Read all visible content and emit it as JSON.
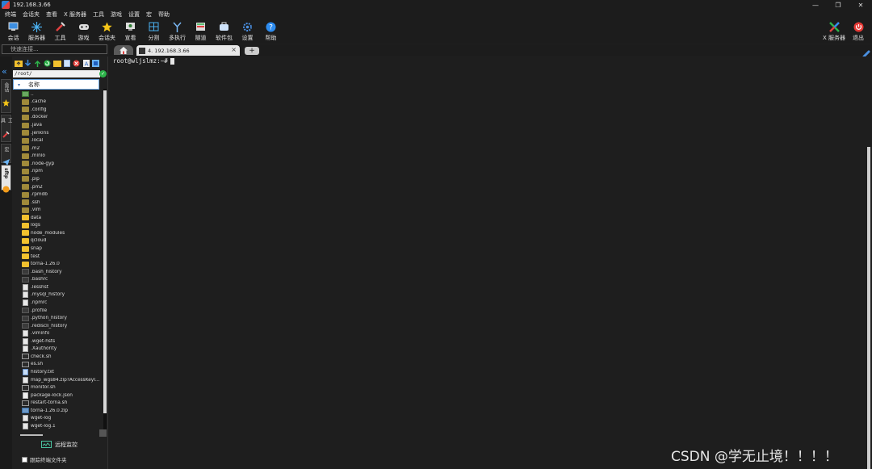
{
  "window": {
    "title": "192.168.3.66"
  },
  "menu": [
    "终端",
    "会话夹",
    "查看",
    "X 服务器",
    "工具",
    "游戏",
    "设置",
    "宏",
    "帮助"
  ],
  "toolbar": {
    "left": [
      {
        "label": "会话",
        "icon": "session-icon"
      },
      {
        "label": "服务器",
        "icon": "servers-icon"
      },
      {
        "label": "工具",
        "icon": "tools-icon"
      },
      {
        "label": "游戏",
        "icon": "games-icon"
      },
      {
        "label": "会话夹",
        "icon": "favorites-icon"
      },
      {
        "label": "宣看",
        "icon": "view-icon"
      },
      {
        "label": "分割",
        "icon": "split-icon"
      },
      {
        "label": "多执行",
        "icon": "multiexec-icon"
      },
      {
        "label": "隧道",
        "icon": "tunnel-icon"
      },
      {
        "label": "软件包",
        "icon": "packages-icon"
      },
      {
        "label": "设置",
        "icon": "settings-icon"
      },
      {
        "label": "帮助",
        "icon": "help-icon"
      }
    ],
    "right": [
      {
        "label": "X 服务器",
        "icon": "x-server-icon"
      },
      {
        "label": "退出",
        "icon": "power-icon"
      }
    ]
  },
  "quickconnect": {
    "placeholder": "快速连接..."
  },
  "tabs": {
    "session_label": "4. 192.168.3.66",
    "close": "×",
    "add": "+"
  },
  "vtabs": [
    {
      "label": "会话",
      "icon": "star-icon"
    },
    {
      "label": "工具",
      "icon": "tools-icon"
    },
    {
      "label": "宏",
      "icon": "send-icon"
    },
    {
      "label": "sftp",
      "icon": "sftp-icon"
    }
  ],
  "sftp": {
    "path": "/root/",
    "column_header": "名称",
    "files": [
      {
        "name": "..",
        "kind": "up"
      },
      {
        "name": ".cache",
        "kind": "dir-dot"
      },
      {
        "name": ".config",
        "kind": "dir-dot"
      },
      {
        "name": ".docker",
        "kind": "dir-dot"
      },
      {
        "name": ".java",
        "kind": "dir-dot"
      },
      {
        "name": ".jenkins",
        "kind": "dir-dot"
      },
      {
        "name": ".local",
        "kind": "dir-dot"
      },
      {
        "name": ".m2",
        "kind": "dir-dot"
      },
      {
        "name": ".minio",
        "kind": "dir-dot"
      },
      {
        "name": ".node-gyp",
        "kind": "dir-dot"
      },
      {
        "name": ".npm",
        "kind": "dir-dot"
      },
      {
        "name": ".pip",
        "kind": "dir-dot"
      },
      {
        "name": ".pm2",
        "kind": "dir-dot"
      },
      {
        "name": ".rpmdb",
        "kind": "dir-dot"
      },
      {
        "name": ".ssh",
        "kind": "dir-dot"
      },
      {
        "name": ".vim",
        "kind": "dir-dot"
      },
      {
        "name": "data",
        "kind": "dir"
      },
      {
        "name": "logs",
        "kind": "dir"
      },
      {
        "name": "node_modules",
        "kind": "dir"
      },
      {
        "name": "qcloud",
        "kind": "dir"
      },
      {
        "name": "snap",
        "kind": "dir"
      },
      {
        "name": "test",
        "kind": "dir"
      },
      {
        "name": "torna-1.26.0",
        "kind": "dir"
      },
      {
        "name": ".bash_history",
        "kind": "file"
      },
      {
        "name": ".bashrc",
        "kind": "file"
      },
      {
        "name": ".lesshst",
        "kind": "doc"
      },
      {
        "name": ".mysql_history",
        "kind": "doc"
      },
      {
        "name": ".npmrc",
        "kind": "doc"
      },
      {
        "name": ".profile",
        "kind": "file"
      },
      {
        "name": ".python_history",
        "kind": "file"
      },
      {
        "name": ".rediscli_history",
        "kind": "file"
      },
      {
        "name": ".viminfo",
        "kind": "doc"
      },
      {
        "name": ".wget-hsts",
        "kind": "doc"
      },
      {
        "name": ".Xauthority",
        "kind": "doc"
      },
      {
        "name": "check.sh",
        "kind": "sh"
      },
      {
        "name": "es.sh",
        "kind": "sh"
      },
      {
        "name": "history.txt",
        "kind": "txt"
      },
      {
        "name": "map_wgs84.zip?AccessKeyId...",
        "kind": "doc"
      },
      {
        "name": "monitor.sh",
        "kind": "sh"
      },
      {
        "name": "package-lock.json",
        "kind": "json"
      },
      {
        "name": "restart-torna.sh",
        "kind": "sh"
      },
      {
        "name": "torna-1.26.0.zip",
        "kind": "zip"
      },
      {
        "name": "wget-log",
        "kind": "doc"
      },
      {
        "name": "wget-log.1",
        "kind": "doc"
      }
    ],
    "monitor_label": "远程监控",
    "follow_label": "跟踪终端文件夹"
  },
  "terminal": {
    "prompt": "root@wljslmz:~#"
  },
  "watermark": "CSDN @学无止境！！！！",
  "colors": {
    "accent": "#4aa3ff",
    "ok": "#2db34a",
    "folder": "#f2c12e",
    "exit": "#e53935"
  }
}
